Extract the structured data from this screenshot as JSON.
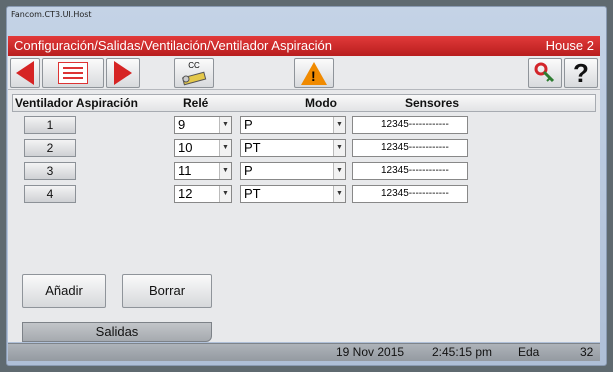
{
  "os_title": "Fancom.CT3.UI.Host",
  "titlebar": {
    "path": "Configuración/Salidas/Ventilación/Ventilador Aspiración",
    "house": "House 2"
  },
  "toolbar": {
    "prev_icon": "red-left-arrow-icon",
    "list_icon": "list-view-icon",
    "next_icon": "red-right-arrow-icon",
    "cc_label": "CC",
    "warning_icon": "warning-triangle-icon",
    "help_label": "?"
  },
  "table": {
    "headers": [
      "Ventilador Aspiración",
      "Relé",
      "Modo",
      "Sensores"
    ],
    "rows": [
      {
        "index": "1",
        "rele": "9",
        "modo": "P",
        "sensores": "12345------------"
      },
      {
        "index": "2",
        "rele": "10",
        "modo": "PT",
        "sensores": "12345------------"
      },
      {
        "index": "3",
        "rele": "11",
        "modo": "P",
        "sensores": "12345------------"
      },
      {
        "index": "4",
        "rele": "12",
        "modo": "PT",
        "sensores": "12345------------"
      }
    ]
  },
  "buttons": {
    "add": "Añadir",
    "delete": "Borrar"
  },
  "tabs": {
    "active": "Salidas"
  },
  "status": {
    "date": "19 Nov 2015",
    "time": "2:45:15 pm",
    "user": "Eda",
    "number": "32"
  },
  "colors": {
    "title_red": "#c82323",
    "accent_orange": "#f08a00"
  }
}
